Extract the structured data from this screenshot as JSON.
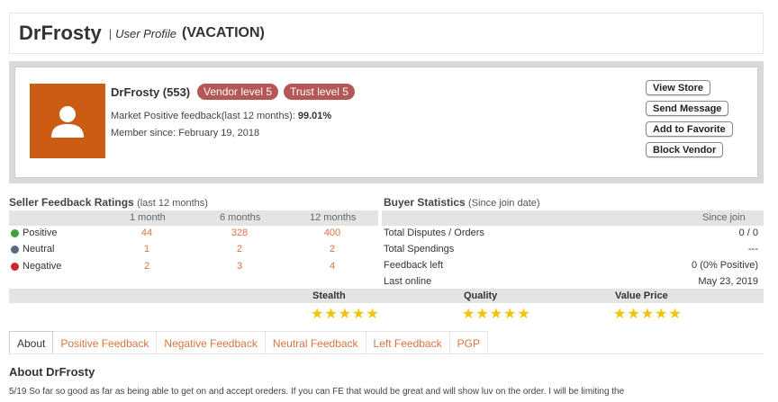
{
  "header": {
    "name": "DrFrosty",
    "separator": "|",
    "subtitle": "User Profile",
    "status": "(VACATION)"
  },
  "profile": {
    "avatar_icon": "user-silhouette-icon",
    "name_count": "DrFrosty (553)",
    "badges": [
      "Vendor level 5",
      "Trust level 5"
    ],
    "feedback_label": "Market Positive feedback(last 12 months):",
    "feedback_value": "99.01%",
    "member_since": "Member since: February 19, 2018",
    "buttons": [
      "View Store",
      "Send Message",
      "Add to Favorite",
      "Block Vendor"
    ]
  },
  "seller": {
    "title": "Seller Feedback Ratings",
    "title_note": "(last 12 months)",
    "columns": [
      "1 month",
      "6 months",
      "12 months"
    ],
    "rows": [
      {
        "label": "Positive",
        "icon": "plus-circle-icon",
        "values": [
          "44",
          "328",
          "400"
        ]
      },
      {
        "label": "Neutral",
        "icon": "neutral-circle-icon",
        "values": [
          "1",
          "2",
          "2"
        ]
      },
      {
        "label": "Negative",
        "icon": "minus-circle-icon",
        "values": [
          "2",
          "3",
          "4"
        ]
      }
    ]
  },
  "buyer": {
    "title": "Buyer Statistics",
    "title_note": "(Since join date)",
    "column": "Since join",
    "rows": [
      {
        "label": "Total Disputes / Orders",
        "value": "0 / 0"
      },
      {
        "label": "Total Spendings",
        "value": "---"
      },
      {
        "label": "Feedback left",
        "value": "0 (0% Positive)"
      },
      {
        "label": "Last online",
        "value": "May 23, 2019"
      }
    ]
  },
  "stats": [
    {
      "label": "Stealth",
      "stars": 5
    },
    {
      "label": "Quality",
      "stars": 5
    },
    {
      "label": "Value Price",
      "stars": 5
    }
  ],
  "colors": {
    "accent": "#d9743e",
    "badge": "#b55757",
    "avatar_bg": "#cc5c14",
    "star": "#f2c400"
  },
  "tabs": [
    "About",
    "Positive Feedback",
    "Negative Feedback",
    "Neutral Feedback",
    "Left Feedback",
    "PGP"
  ],
  "about": {
    "title": "About DrFrosty",
    "text": "5/19 So far so good as far as being able to get on and accept oreders. If you can FE that would be great and will show luv on the order.  I will be limiting the"
  }
}
